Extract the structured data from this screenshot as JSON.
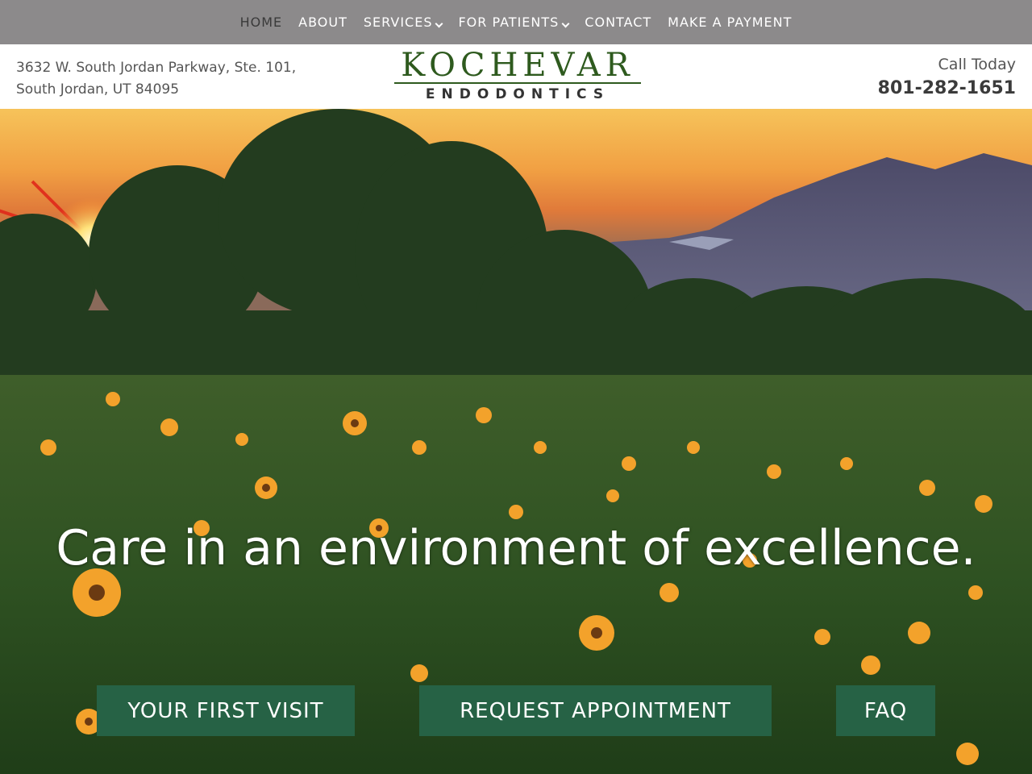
{
  "nav": {
    "items": [
      {
        "label": "HOME",
        "active": true,
        "dropdown": false
      },
      {
        "label": "ABOUT",
        "active": false,
        "dropdown": false
      },
      {
        "label": "SERVICES",
        "active": false,
        "dropdown": true
      },
      {
        "label": "FOR PATIENTS",
        "active": false,
        "dropdown": true
      },
      {
        "label": "CONTACT",
        "active": false,
        "dropdown": false
      },
      {
        "label": "MAKE A PAYMENT",
        "active": false,
        "dropdown": false
      }
    ]
  },
  "header": {
    "address_line1": "3632 W. South Jordan Parkway, Ste. 101,",
    "address_line2": "South Jordan, UT 84095",
    "logo_top": "KOCHEVAR",
    "logo_bottom": "ENDODONTICS",
    "call_label": "Call Today",
    "phone": "801-282-1651"
  },
  "hero": {
    "tagline": "Care in an environment of excellence.",
    "buttons": [
      {
        "label": "YOUR FIRST VISIT"
      },
      {
        "label": "REQUEST APPOINTMENT"
      },
      {
        "label": "FAQ"
      }
    ]
  },
  "colors": {
    "nav_bg": "#8c8a8b",
    "brand_green": "#2e5a1e",
    "cta_green": "#266245"
  }
}
